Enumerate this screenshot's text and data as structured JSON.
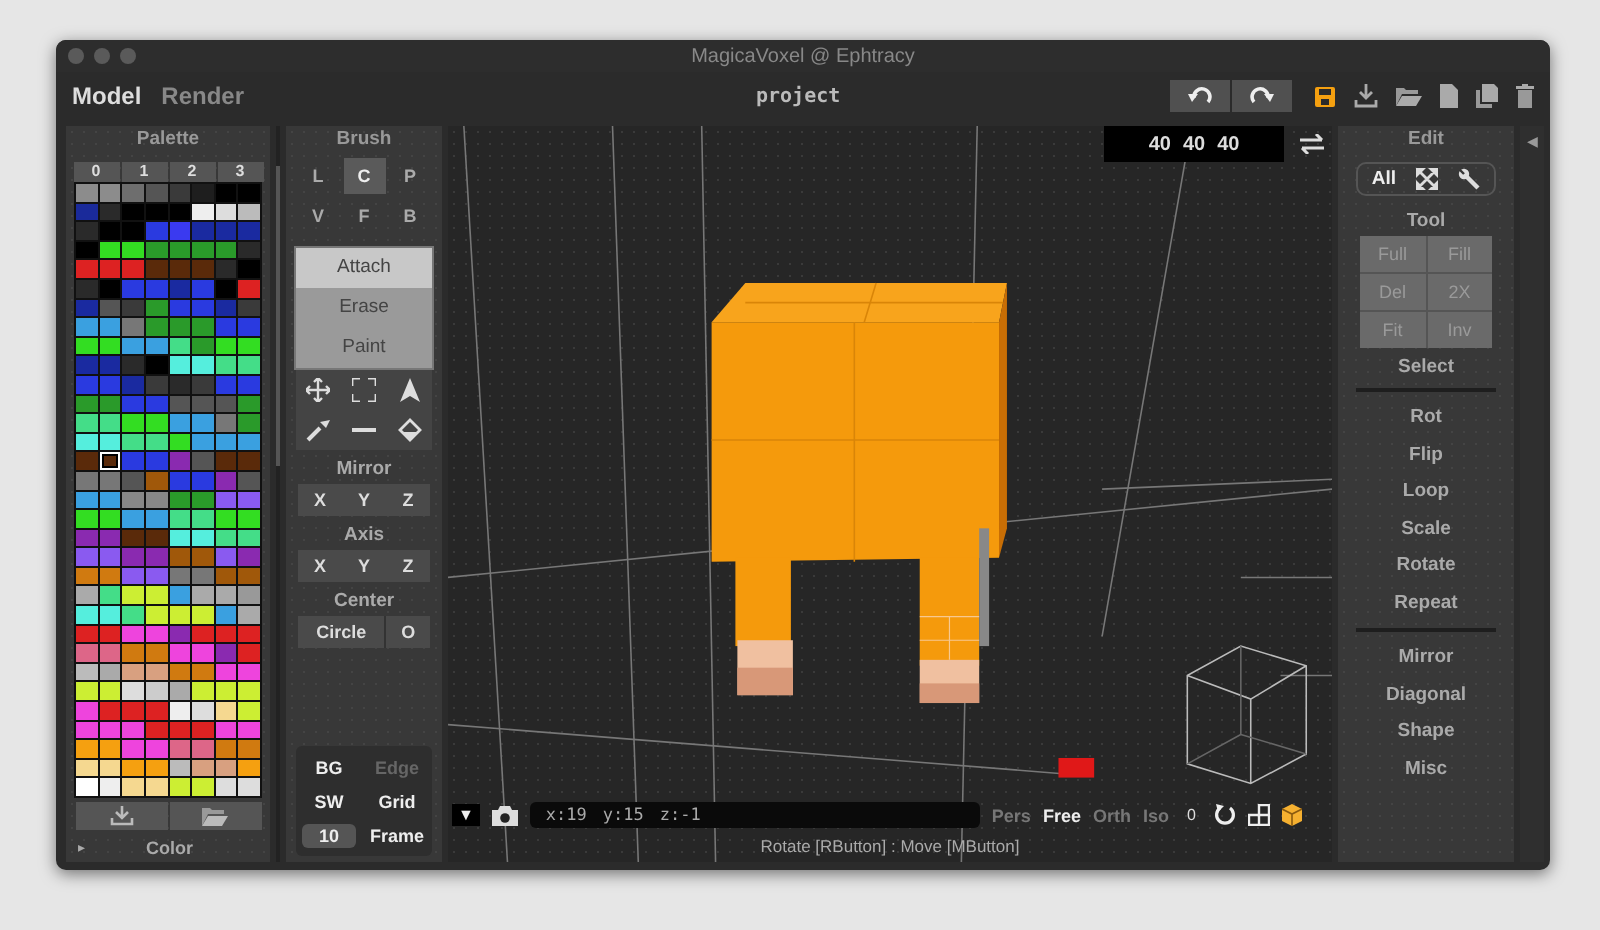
{
  "window": {
    "title": "MagicaVoxel @ Ephtracy"
  },
  "modes": [
    {
      "label": "Model",
      "selected": true
    },
    {
      "label": "Render",
      "selected": false
    }
  ],
  "project": "project",
  "palette": {
    "title": "Palette",
    "pages": [
      {
        "label": "0",
        "selected": false
      },
      {
        "label": "1",
        "selected": false
      },
      {
        "label": "2",
        "selected": false
      },
      {
        "label": "3",
        "selected": false
      }
    ],
    "rows": [
      [
        {
          "color": "#8c8c8c",
          "selected": false
        },
        {
          "color": "#8c8c8c",
          "selected": false
        },
        {
          "color": "#6e6e6e",
          "selected": false
        },
        {
          "color": "#555555",
          "selected": false
        },
        {
          "color": "#3a3a3a",
          "selected": false
        },
        {
          "color": "#1e1e1e",
          "selected": false
        },
        {
          "color": "#000000",
          "selected": false
        },
        {
          "color": "#000000",
          "selected": false
        }
      ],
      [
        {
          "color": "#1a2a9a",
          "selected": false
        },
        {
          "color": "#2a2a2a",
          "selected": false
        },
        {
          "color": "#000000",
          "selected": false
        },
        {
          "color": "#000000",
          "selected": false
        },
        {
          "color": "#000000",
          "selected": false
        },
        {
          "color": "#eeeeee",
          "selected": false
        },
        {
          "color": "#dddddd",
          "selected": false
        },
        {
          "color": "#bbbbbb",
          "selected": false
        }
      ],
      [
        {
          "color": "#2a2a2a",
          "selected": false
        },
        {
          "color": "#000000",
          "selected": false
        },
        {
          "color": "#000000",
          "selected": false
        },
        {
          "color": "#2a3ae0",
          "selected": false
        },
        {
          "color": "#3a3af0",
          "selected": false
        },
        {
          "color": "#1a2aa0",
          "selected": false
        },
        {
          "color": "#1a2aa0",
          "selected": false
        },
        {
          "color": "#1a2aa0",
          "selected": false
        }
      ],
      [
        {
          "color": "#000000",
          "selected": false
        },
        {
          "color": "#33dd22",
          "selected": false
        },
        {
          "color": "#33dd22",
          "selected": false
        },
        {
          "color": "#2a9a2a",
          "selected": false
        },
        {
          "color": "#2a9a2a",
          "selected": false
        },
        {
          "color": "#2a9a2a",
          "selected": false
        },
        {
          "color": "#2a9a2a",
          "selected": false
        },
        {
          "color": "#2a2a2a",
          "selected": false
        }
      ],
      [
        {
          "color": "#dd2222",
          "selected": false
        },
        {
          "color": "#dd2222",
          "selected": false
        },
        {
          "color": "#dd2222",
          "selected": false
        },
        {
          "color": "#5a2a0a",
          "selected": false
        },
        {
          "color": "#5a2a0a",
          "selected": false
        },
        {
          "color": "#5a2a0a",
          "selected": false
        },
        {
          "color": "#2a2a2a",
          "selected": false
        },
        {
          "color": "#000000",
          "selected": false
        }
      ],
      [
        {
          "color": "#2a2a2a",
          "selected": false
        },
        {
          "color": "#000000",
          "selected": false
        },
        {
          "color": "#2a3ae0",
          "selected": false
        },
        {
          "color": "#2a3ae0",
          "selected": false
        },
        {
          "color": "#1a2aa0",
          "selected": false
        },
        {
          "color": "#2a3ae0",
          "selected": false
        },
        {
          "color": "#000000",
          "selected": false
        },
        {
          "color": "#dd2222",
          "selected": false
        }
      ],
      [
        {
          "color": "#1a2aa0",
          "selected": false
        },
        {
          "color": "#555555",
          "selected": false
        },
        {
          "color": "#3a3a3a",
          "selected": false
        },
        {
          "color": "#2a9a2a",
          "selected": false
        },
        {
          "color": "#2a3ae0",
          "selected": false
        },
        {
          "color": "#2a3ae0",
          "selected": false
        },
        {
          "color": "#1a2aa0",
          "selected": false
        },
        {
          "color": "#3a3a3a",
          "selected": false
        }
      ],
      [
        {
          "color": "#3aa0e0",
          "selected": false
        },
        {
          "color": "#3aa0e0",
          "selected": false
        },
        {
          "color": "#777777",
          "selected": false
        },
        {
          "color": "#2a9a2a",
          "selected": false
        },
        {
          "color": "#2a9a2a",
          "selected": false
        },
        {
          "color": "#2a9a2a",
          "selected": false
        },
        {
          "color": "#2a3ae0",
          "selected": false
        },
        {
          "color": "#2a3ae0",
          "selected": false
        }
      ],
      [
        {
          "color": "#33dd22",
          "selected": false
        },
        {
          "color": "#33dd22",
          "selected": false
        },
        {
          "color": "#3aa0e0",
          "selected": false
        },
        {
          "color": "#3aa0e0",
          "selected": false
        },
        {
          "color": "#44dd88",
          "selected": false
        },
        {
          "color": "#2a9a2a",
          "selected": false
        },
        {
          "color": "#33dd22",
          "selected": false
        },
        {
          "color": "#33dd22",
          "selected": false
        }
      ],
      [
        {
          "color": "#1a2aa0",
          "selected": false
        },
        {
          "color": "#1a2aa0",
          "selected": false
        },
        {
          "color": "#2a2a2a",
          "selected": false
        },
        {
          "color": "#000000",
          "selected": false
        },
        {
          "color": "#55eedd",
          "selected": false
        },
        {
          "color": "#55eedd",
          "selected": false
        },
        {
          "color": "#44dd88",
          "selected": false
        },
        {
          "color": "#44dd88",
          "selected": false
        }
      ],
      [
        {
          "color": "#2a3ae0",
          "selected": false
        },
        {
          "color": "#2a3ae0",
          "selected": false
        },
        {
          "color": "#1a2aa0",
          "selected": false
        },
        {
          "color": "#3a3a3a",
          "selected": false
        },
        {
          "color": "#2a2a2a",
          "selected": false
        },
        {
          "color": "#3a3a3a",
          "selected": false
        },
        {
          "color": "#2a3ae0",
          "selected": false
        },
        {
          "color": "#2a3ae0",
          "selected": false
        }
      ],
      [
        {
          "color": "#2a9a2a",
          "selected": false
        },
        {
          "color": "#2a9a2a",
          "selected": false
        },
        {
          "color": "#2a3ae0",
          "selected": false
        },
        {
          "color": "#2a3ae0",
          "selected": false
        },
        {
          "color": "#555555",
          "selected": false
        },
        {
          "color": "#555555",
          "selected": false
        },
        {
          "color": "#555555",
          "selected": false
        },
        {
          "color": "#2a9a2a",
          "selected": false
        }
      ],
      [
        {
          "color": "#44dd88",
          "selected": false
        },
        {
          "color": "#44dd88",
          "selected": false
        },
        {
          "color": "#33dd22",
          "selected": false
        },
        {
          "color": "#33dd22",
          "selected": false
        },
        {
          "color": "#3aa0e0",
          "selected": false
        },
        {
          "color": "#3aa0e0",
          "selected": false
        },
        {
          "color": "#777777",
          "selected": false
        },
        {
          "color": "#2a9a2a",
          "selected": false
        }
      ],
      [
        {
          "color": "#55eedd",
          "selected": false
        },
        {
          "color": "#55eedd",
          "selected": false
        },
        {
          "color": "#44dd88",
          "selected": false
        },
        {
          "color": "#44dd88",
          "selected": false
        },
        {
          "color": "#33dd22",
          "selected": false
        },
        {
          "color": "#3aa0e0",
          "selected": false
        },
        {
          "color": "#3aa0e0",
          "selected": false
        },
        {
          "color": "#3aa0e0",
          "selected": false
        }
      ],
      [
        {
          "color": "#5a2a0a",
          "selected": false
        },
        {
          "color": "#5a2a0a",
          "selected": true
        },
        {
          "color": "#2a3ae0",
          "selected": false
        },
        {
          "color": "#2a3ae0",
          "selected": false
        },
        {
          "color": "#8a2ab0",
          "selected": false
        },
        {
          "color": "#555555",
          "selected": false
        },
        {
          "color": "#5a2a0a",
          "selected": false
        },
        {
          "color": "#5a2a0a",
          "selected": false
        }
      ],
      [
        {
          "color": "#777777",
          "selected": false
        },
        {
          "color": "#777777",
          "selected": false
        },
        {
          "color": "#555555",
          "selected": false
        },
        {
          "color": "#a0580a",
          "selected": false
        },
        {
          "color": "#2a3ae0",
          "selected": false
        },
        {
          "color": "#2a3ae0",
          "selected": false
        },
        {
          "color": "#8a2ab0",
          "selected": false
        },
        {
          "color": "#555555",
          "selected": false
        }
      ],
      [
        {
          "color": "#3aa0e0",
          "selected": false
        },
        {
          "color": "#3aa0e0",
          "selected": false
        },
        {
          "color": "#888888",
          "selected": false
        },
        {
          "color": "#888888",
          "selected": false
        },
        {
          "color": "#2a9a2a",
          "selected": false
        },
        {
          "color": "#2a9a2a",
          "selected": false
        },
        {
          "color": "#8a5af0",
          "selected": false
        },
        {
          "color": "#8a5af0",
          "selected": false
        }
      ],
      [
        {
          "color": "#33dd22",
          "selected": false
        },
        {
          "color": "#33dd22",
          "selected": false
        },
        {
          "color": "#3aa0e0",
          "selected": false
        },
        {
          "color": "#3aa0e0",
          "selected": false
        },
        {
          "color": "#44dd88",
          "selected": false
        },
        {
          "color": "#44dd88",
          "selected": false
        },
        {
          "color": "#33dd22",
          "selected": false
        },
        {
          "color": "#33dd22",
          "selected": false
        }
      ],
      [
        {
          "color": "#8a2ab0",
          "selected": false
        },
        {
          "color": "#8a2ab0",
          "selected": false
        },
        {
          "color": "#5a2a0a",
          "selected": false
        },
        {
          "color": "#5a2a0a",
          "selected": false
        },
        {
          "color": "#55eedd",
          "selected": false
        },
        {
          "color": "#55eedd",
          "selected": false
        },
        {
          "color": "#44dd88",
          "selected": false
        },
        {
          "color": "#44dd88",
          "selected": false
        }
      ],
      [
        {
          "color": "#8a5af0",
          "selected": false
        },
        {
          "color": "#8a5af0",
          "selected": false
        },
        {
          "color": "#8a2ab0",
          "selected": false
        },
        {
          "color": "#8a2ab0",
          "selected": false
        },
        {
          "color": "#a0580a",
          "selected": false
        },
        {
          "color": "#a0580a",
          "selected": false
        },
        {
          "color": "#8a5af0",
          "selected": false
        },
        {
          "color": "#8a2ab0",
          "selected": false
        }
      ],
      [
        {
          "color": "#d07a10",
          "selected": false
        },
        {
          "color": "#d07a10",
          "selected": false
        },
        {
          "color": "#8a5af0",
          "selected": false
        },
        {
          "color": "#8a5af0",
          "selected": false
        },
        {
          "color": "#777777",
          "selected": false
        },
        {
          "color": "#777777",
          "selected": false
        },
        {
          "color": "#a0580a",
          "selected": false
        },
        {
          "color": "#a0580a",
          "selected": false
        }
      ],
      [
        {
          "color": "#aaaaaa",
          "selected": false
        },
        {
          "color": "#44dd88",
          "selected": false
        },
        {
          "color": "#ccee33",
          "selected": false
        },
        {
          "color": "#ccee33",
          "selected": false
        },
        {
          "color": "#3aa0e0",
          "selected": false
        },
        {
          "color": "#aaaaaa",
          "selected": false
        },
        {
          "color": "#aaaaaa",
          "selected": false
        },
        {
          "color": "#999999",
          "selected": false
        }
      ],
      [
        {
          "color": "#55eedd",
          "selected": false
        },
        {
          "color": "#55eedd",
          "selected": false
        },
        {
          "color": "#44dd88",
          "selected": false
        },
        {
          "color": "#ccee33",
          "selected": false
        },
        {
          "color": "#ccee33",
          "selected": false
        },
        {
          "color": "#ccee33",
          "selected": false
        },
        {
          "color": "#3aa0e0",
          "selected": false
        },
        {
          "color": "#aaaaaa",
          "selected": false
        }
      ],
      [
        {
          "color": "#dd2222",
          "selected": false
        },
        {
          "color": "#dd2222",
          "selected": false
        },
        {
          "color": "#ee44dd",
          "selected": false
        },
        {
          "color": "#ee44dd",
          "selected": false
        },
        {
          "color": "#8a2ab0",
          "selected": false
        },
        {
          "color": "#dd2222",
          "selected": false
        },
        {
          "color": "#dd2222",
          "selected": false
        },
        {
          "color": "#dd2222",
          "selected": false
        }
      ],
      [
        {
          "color": "#dd6688",
          "selected": false
        },
        {
          "color": "#dd6688",
          "selected": false
        },
        {
          "color": "#d07a10",
          "selected": false
        },
        {
          "color": "#d07a10",
          "selected": false
        },
        {
          "color": "#ee44dd",
          "selected": false
        },
        {
          "color": "#ee44dd",
          "selected": false
        },
        {
          "color": "#8a2ab0",
          "selected": false
        },
        {
          "color": "#dd2222",
          "selected": false
        }
      ],
      [
        {
          "color": "#bbbbbb",
          "selected": false
        },
        {
          "color": "#aaaaaa",
          "selected": false
        },
        {
          "color": "#d8a080",
          "selected": false
        },
        {
          "color": "#d8a080",
          "selected": false
        },
        {
          "color": "#d07a10",
          "selected": false
        },
        {
          "color": "#d07a10",
          "selected": false
        },
        {
          "color": "#ee44dd",
          "selected": false
        },
        {
          "color": "#ee44dd",
          "selected": false
        }
      ],
      [
        {
          "color": "#ccee33",
          "selected": false
        },
        {
          "color": "#ccee33",
          "selected": false
        },
        {
          "color": "#dddddd",
          "selected": false
        },
        {
          "color": "#cccccc",
          "selected": false
        },
        {
          "color": "#aaaaaa",
          "selected": false
        },
        {
          "color": "#ccee33",
          "selected": false
        },
        {
          "color": "#ccee33",
          "selected": false
        },
        {
          "color": "#ccee33",
          "selected": false
        }
      ],
      [
        {
          "color": "#ee44dd",
          "selected": false
        },
        {
          "color": "#dd2222",
          "selected": false
        },
        {
          "color": "#dd2222",
          "selected": false
        },
        {
          "color": "#dd2222",
          "selected": false
        },
        {
          "color": "#eeeeee",
          "selected": false
        },
        {
          "color": "#dddddd",
          "selected": false
        },
        {
          "color": "#f5d890",
          "selected": false
        },
        {
          "color": "#ccee33",
          "selected": false
        }
      ],
      [
        {
          "color": "#ee44dd",
          "selected": false
        },
        {
          "color": "#ee44dd",
          "selected": false
        },
        {
          "color": "#ee44dd",
          "selected": false
        },
        {
          "color": "#dd2222",
          "selected": false
        },
        {
          "color": "#dd2222",
          "selected": false
        },
        {
          "color": "#dd2222",
          "selected": false
        },
        {
          "color": "#ee44dd",
          "selected": false
        },
        {
          "color": "#ee44dd",
          "selected": false
        }
      ],
      [
        {
          "color": "#f5a010",
          "selected": false
        },
        {
          "color": "#f5a010",
          "selected": false
        },
        {
          "color": "#ee44dd",
          "selected": false
        },
        {
          "color": "#ee44dd",
          "selected": false
        },
        {
          "color": "#dd6688",
          "selected": false
        },
        {
          "color": "#dd6688",
          "selected": false
        },
        {
          "color": "#d07a10",
          "selected": false
        },
        {
          "color": "#d07a10",
          "selected": false
        }
      ],
      [
        {
          "color": "#f5d890",
          "selected": false
        },
        {
          "color": "#f5d890",
          "selected": false
        },
        {
          "color": "#f5a010",
          "selected": false
        },
        {
          "color": "#f5a010",
          "selected": false
        },
        {
          "color": "#bbbbbb",
          "selected": false
        },
        {
          "color": "#d8a080",
          "selected": false
        },
        {
          "color": "#d8a080",
          "selected": false
        },
        {
          "color": "#f5a010",
          "selected": false
        }
      ],
      [
        {
          "color": "#ffffff",
          "selected": false
        },
        {
          "color": "#eeeeee",
          "selected": false
        },
        {
          "color": "#f5d890",
          "selected": false
        },
        {
          "color": "#f5d890",
          "selected": false
        },
        {
          "color": "#ccee33",
          "selected": false
        },
        {
          "color": "#ccee33",
          "selected": false
        },
        {
          "color": "#dddddd",
          "selected": false
        },
        {
          "color": "#dddddd",
          "selected": false
        }
      ]
    ],
    "expander": "▸",
    "footer_label": "Color"
  },
  "brush": {
    "title": "Brush",
    "types": [
      {
        "label": "L",
        "selected": false
      },
      {
        "label": "C",
        "selected": true
      },
      {
        "label": "P",
        "selected": false
      },
      {
        "label": "V",
        "selected": false
      },
      {
        "label": "F",
        "selected": false
      },
      {
        "label": "B",
        "selected": false
      }
    ],
    "modes": [
      {
        "label": "Attach",
        "selected": true
      },
      {
        "label": "Erase",
        "selected": false
      },
      {
        "label": "Paint",
        "selected": false
      }
    ],
    "mirror": {
      "title": "Mirror",
      "axes": [
        {
          "label": "X",
          "selected": false
        },
        {
          "label": "Y",
          "selected": false
        },
        {
          "label": "Z",
          "selected": false
        }
      ]
    },
    "axis": {
      "title": "Axis",
      "axes": [
        {
          "label": "X",
          "selected": false
        },
        {
          "label": "Y",
          "selected": false
        },
        {
          "label": "Z",
          "selected": false
        }
      ]
    },
    "center": {
      "title": "Center",
      "buttons": [
        {
          "label": "Circle"
        },
        {
          "label": "O"
        }
      ]
    },
    "display": [
      {
        "label": "BG",
        "kind": "toggle",
        "disabled": false
      },
      {
        "label": "Edge",
        "kind": "toggle",
        "disabled": true
      },
      {
        "label": "SW",
        "kind": "toggle",
        "disabled": false
      },
      {
        "label": "Grid",
        "kind": "toggle",
        "disabled": false
      },
      {
        "label": "10",
        "kind": "field",
        "disabled": false
      },
      {
        "label": "Frame",
        "kind": "toggle",
        "disabled": false
      }
    ]
  },
  "viewport": {
    "size": [
      "40",
      "40",
      "40"
    ],
    "menu_glyph": "▼",
    "coordinates": [
      "x:19",
      "y:15",
      "z:-1"
    ],
    "views": [
      {
        "label": "Pers",
        "selected": false
      },
      {
        "label": "Free",
        "selected": true
      },
      {
        "label": "Orth",
        "selected": false
      },
      {
        "label": "Iso",
        "selected": false
      }
    ],
    "zoom": "0",
    "hint": "Rotate [RButton] : Move [MButton]"
  },
  "edit": {
    "title": "Edit",
    "all": "All",
    "tool_title": "Tool",
    "tools": [
      {
        "label": "Full",
        "disabled": true
      },
      {
        "label": "Fill",
        "disabled": true
      },
      {
        "label": "Del",
        "disabled": true
      },
      {
        "label": "2X",
        "disabled": true
      },
      {
        "label": "Fit",
        "disabled": true
      },
      {
        "label": "Inv",
        "disabled": true
      }
    ],
    "select": "Select",
    "actions": [
      "Rot",
      "Flip",
      "Loop",
      "Scale",
      "Rotate",
      "Repeat"
    ],
    "more": [
      "Mirror",
      "Diagonal",
      "Shape",
      "Misc"
    ]
  },
  "collapse_glyph": "◀"
}
